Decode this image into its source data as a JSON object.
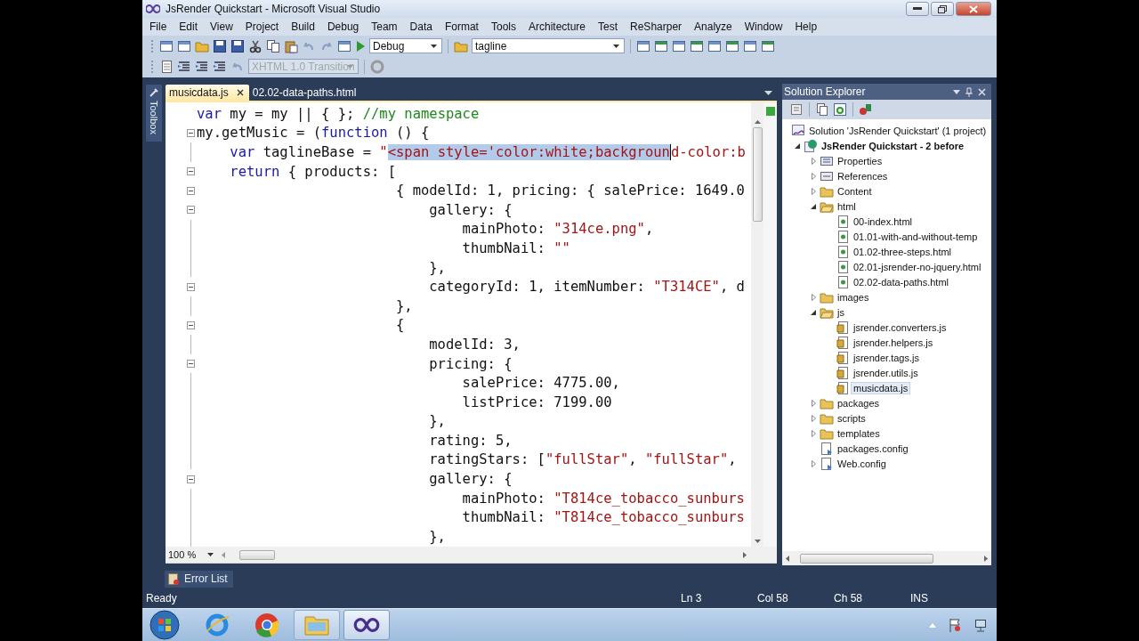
{
  "window": {
    "title": "JsRender Quickstart - Microsoft Visual Studio"
  },
  "menu": [
    "File",
    "Edit",
    "View",
    "Project",
    "Build",
    "Debug",
    "Team",
    "Data",
    "Format",
    "Tools",
    "Architecture",
    "Test",
    "ReSharper",
    "Analyze",
    "Window",
    "Help"
  ],
  "toolbar": {
    "configuration": "Debug",
    "find": "tagline",
    "doctype": {
      "value": "XHTML 1.0 Transition",
      "disabled": true
    }
  },
  "toolbox": {
    "label": "Toolbox"
  },
  "editor": {
    "tabs": [
      {
        "label": "musicdata.js",
        "selected": true
      },
      {
        "label": "02.02-data-paths.html",
        "selected": false
      }
    ],
    "lines": [
      {
        "kind": "plain",
        "tokens": [
          {
            "kind": "keyword",
            "text": "var"
          },
          {
            "kind": "plain",
            "text": " my = my || { }; "
          },
          {
            "kind": "comment",
            "text": "//my namespace"
          }
        ]
      },
      {
        "kind": "start",
        "tokens": [
          {
            "kind": "plain",
            "text": "my.getMusic = ("
          },
          {
            "kind": "keyword",
            "text": "function"
          },
          {
            "kind": "plain",
            "text": " () {"
          }
        ]
      },
      {
        "kind": "inner",
        "tokens": [
          {
            "kind": "keyword",
            "text": "    var"
          },
          {
            "kind": "plain",
            "text": " taglineBase = "
          },
          {
            "kind": "string",
            "text": "\""
          },
          {
            "kind": "selection",
            "text": "<span style='color:white;backgroun"
          },
          {
            "kind": "string",
            "text": "d-color:b"
          }
        ]
      },
      {
        "kind": "start",
        "tokens": [
          {
            "kind": "keyword",
            "text": "    return"
          },
          {
            "kind": "plain",
            "text": " { products: ["
          }
        ]
      },
      {
        "kind": "start",
        "tokens": [
          {
            "kind": "plain",
            "text": "                        { modelId: 1, pricing: { salePrice: 1649.0"
          }
        ]
      },
      {
        "kind": "start",
        "tokens": [
          {
            "kind": "plain",
            "text": "                            gallery: {"
          }
        ]
      },
      {
        "kind": "inner",
        "tokens": [
          {
            "kind": "plain",
            "text": "                                mainPhoto: "
          },
          {
            "kind": "string",
            "text": "\"314ce.png\""
          },
          {
            "kind": "plain",
            "text": ","
          }
        ]
      },
      {
        "kind": "inner",
        "tokens": [
          {
            "kind": "plain",
            "text": "                                thumbNail: "
          },
          {
            "kind": "string",
            "text": "\"\""
          }
        ]
      },
      {
        "kind": "inner",
        "tokens": [
          {
            "kind": "plain",
            "text": "                            },"
          }
        ]
      },
      {
        "kind": "start",
        "tokens": [
          {
            "kind": "plain",
            "text": "                            categoryId: 1, itemNumber: "
          },
          {
            "kind": "string",
            "text": "\"T314CE\""
          },
          {
            "kind": "plain",
            "text": ", d"
          }
        ]
      },
      {
        "kind": "inner",
        "tokens": [
          {
            "kind": "plain",
            "text": "                        },"
          }
        ]
      },
      {
        "kind": "start",
        "tokens": [
          {
            "kind": "plain",
            "text": "                        {"
          }
        ]
      },
      {
        "kind": "inner",
        "tokens": [
          {
            "kind": "plain",
            "text": "                            modelId: 3,"
          }
        ]
      },
      {
        "kind": "start",
        "tokens": [
          {
            "kind": "plain",
            "text": "                            pricing: {"
          }
        ]
      },
      {
        "kind": "inner",
        "tokens": [
          {
            "kind": "plain",
            "text": "                                salePrice: 4775.00,"
          }
        ]
      },
      {
        "kind": "inner",
        "tokens": [
          {
            "kind": "plain",
            "text": "                                listPrice: 7199.00"
          }
        ]
      },
      {
        "kind": "inner",
        "tokens": [
          {
            "kind": "plain",
            "text": "                            },"
          }
        ]
      },
      {
        "kind": "inner",
        "tokens": [
          {
            "kind": "plain",
            "text": "                            rating: 5,"
          }
        ]
      },
      {
        "kind": "inner",
        "tokens": [
          {
            "kind": "plain",
            "text": "                            ratingStars: ["
          },
          {
            "kind": "string",
            "text": "\"fullStar\""
          },
          {
            "kind": "plain",
            "text": ", "
          },
          {
            "kind": "string",
            "text": "\"fullStar\""
          },
          {
            "kind": "plain",
            "text": ","
          }
        ]
      },
      {
        "kind": "start",
        "tokens": [
          {
            "kind": "plain",
            "text": "                            gallery: {"
          }
        ]
      },
      {
        "kind": "inner",
        "tokens": [
          {
            "kind": "plain",
            "text": "                                mainPhoto: "
          },
          {
            "kind": "string",
            "text": "\"T814ce_tobacco_sunburs"
          }
        ]
      },
      {
        "kind": "inner",
        "tokens": [
          {
            "kind": "plain",
            "text": "                                thumbNail: "
          },
          {
            "kind": "string",
            "text": "\"T814ce_tobacco_sunburs"
          }
        ]
      },
      {
        "kind": "inner",
        "tokens": [
          {
            "kind": "plain",
            "text": "                            },"
          }
        ]
      }
    ],
    "zoom": "100 %"
  },
  "solution_explorer": {
    "title": "Solution Explorer",
    "tree": [
      {
        "label": "Solution 'JsRender Quickstart' (1 project)",
        "kind": "solution",
        "selected": false,
        "children": [
          {
            "label": "JsRender Quickstart - 2 before",
            "kind": "project",
            "expanded": true,
            "selected": false,
            "children": [
              {
                "label": "Properties",
                "kind": "properties",
                "expanded": false,
                "selected": false
              },
              {
                "label": "References",
                "kind": "references",
                "expanded": false,
                "selected": false
              },
              {
                "label": "Content",
                "kind": "folder",
                "expanded": false,
                "selected": false
              },
              {
                "label": "html",
                "kind": "folder",
                "expanded": true,
                "selected": false,
                "children": [
                  {
                    "label": "00-index.html",
                    "kind": "html",
                    "selected": false
                  },
                  {
                    "label": "01.01-with-and-without-temp",
                    "kind": "html",
                    "selected": false
                  },
                  {
                    "label": "01.02-three-steps.html",
                    "kind": "html",
                    "selected": false
                  },
                  {
                    "label": "02.01-jsrender-no-jquery.html",
                    "kind": "html",
                    "selected": false
                  },
                  {
                    "label": "02.02-data-paths.html",
                    "kind": "html",
                    "selected": false
                  }
                ]
              },
              {
                "label": "images",
                "kind": "folder",
                "expanded": false,
                "selected": false
              },
              {
                "label": "js",
                "kind": "folder",
                "expanded": true,
                "selected": false,
                "children": [
                  {
                    "label": "jsrender.converters.js",
                    "kind": "js",
                    "selected": false
                  },
                  {
                    "label": "jsrender.helpers.js",
                    "kind": "js",
                    "selected": false
                  },
                  {
                    "label": "jsrender.tags.js",
                    "kind": "js",
                    "selected": false
                  },
                  {
                    "label": "jsrender.utils.js",
                    "kind": "js",
                    "selected": false
                  },
                  {
                    "label": "musicdata.js",
                    "kind": "js",
                    "selected": true
                  }
                ]
              },
              {
                "label": "packages",
                "kind": "folder",
                "expanded": false,
                "selected": false
              },
              {
                "label": "scripts",
                "kind": "folder",
                "expanded": false,
                "selected": false
              },
              {
                "label": "templates",
                "kind": "folder",
                "expanded": false,
                "selected": false
              },
              {
                "label": "packages.config",
                "kind": "config",
                "selected": false
              },
              {
                "label": "Web.config",
                "kind": "config",
                "expanded": false,
                "selected": false
              }
            ]
          }
        ]
      }
    ]
  },
  "bottom_tabs": [
    "Error List"
  ],
  "status_bar": {
    "message": "Ready",
    "line": "Ln 3",
    "column": "Col 58",
    "char": "Ch 58",
    "mode": "INS"
  }
}
